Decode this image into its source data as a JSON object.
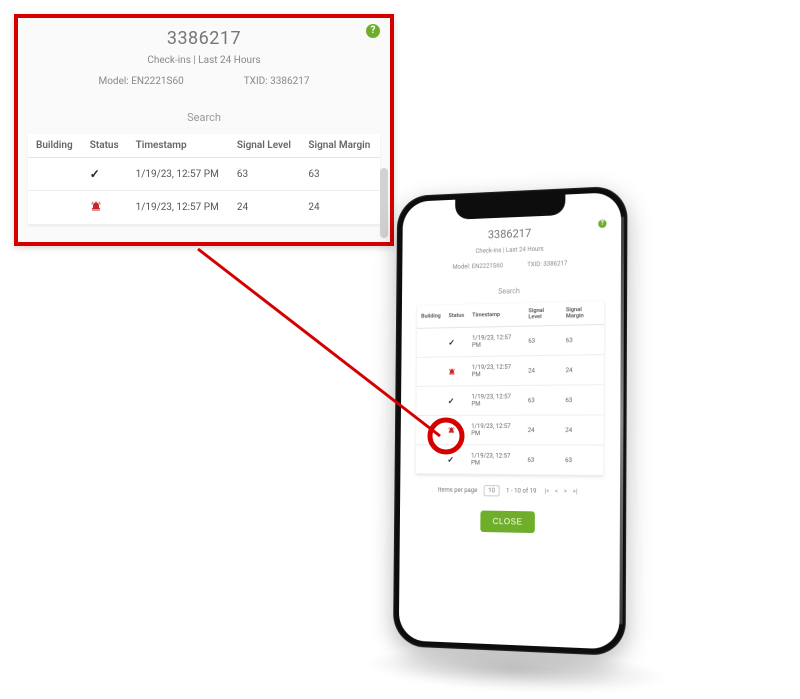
{
  "device_id": "3386217",
  "subtitle": "Check-ins | Last 24 Hours",
  "model_label": "Model:",
  "model_value": "EN2221S60",
  "txid_label": "TXID:",
  "txid_value": "3386217",
  "search_placeholder": "Search",
  "columns": {
    "building": "Building",
    "status": "Status",
    "timestamp": "Timestamp",
    "signal_level": "Signal Level",
    "signal_margin": "Signal Margin"
  },
  "zoom_rows": [
    {
      "status": "ok",
      "timestamp": "1/19/23, 12:57 PM",
      "signal_level": "63",
      "signal_margin": "63"
    },
    {
      "status": "alarm",
      "timestamp": "1/19/23, 12:57 PM",
      "signal_level": "24",
      "signal_margin": "24"
    }
  ],
  "phone_rows": [
    {
      "status": "ok",
      "timestamp": "1/19/23, 12:57 PM",
      "signal_level": "63",
      "signal_margin": "63"
    },
    {
      "status": "alarm",
      "timestamp": "1/19/23, 12:57 PM",
      "signal_level": "24",
      "signal_margin": "24"
    },
    {
      "status": "ok",
      "timestamp": "1/19/23, 12:57 PM",
      "signal_level": "63",
      "signal_margin": "63"
    },
    {
      "status": "alarm",
      "timestamp": "1/19/23, 12:57 PM",
      "signal_level": "24",
      "signal_margin": "24"
    },
    {
      "status": "ok",
      "timestamp": "1/19/23, 12:57 PM",
      "signal_level": "63",
      "signal_margin": "63"
    }
  ],
  "pager": {
    "items_per_page_label": "Items per page",
    "items_per_page_value": "10",
    "range_text": "1 - 10 of 19"
  },
  "close_label": "CLOSE",
  "help_glyph": "?",
  "colors": {
    "accent": "#6fae2b",
    "alarm": "#c62828",
    "callout": "#d40000"
  }
}
